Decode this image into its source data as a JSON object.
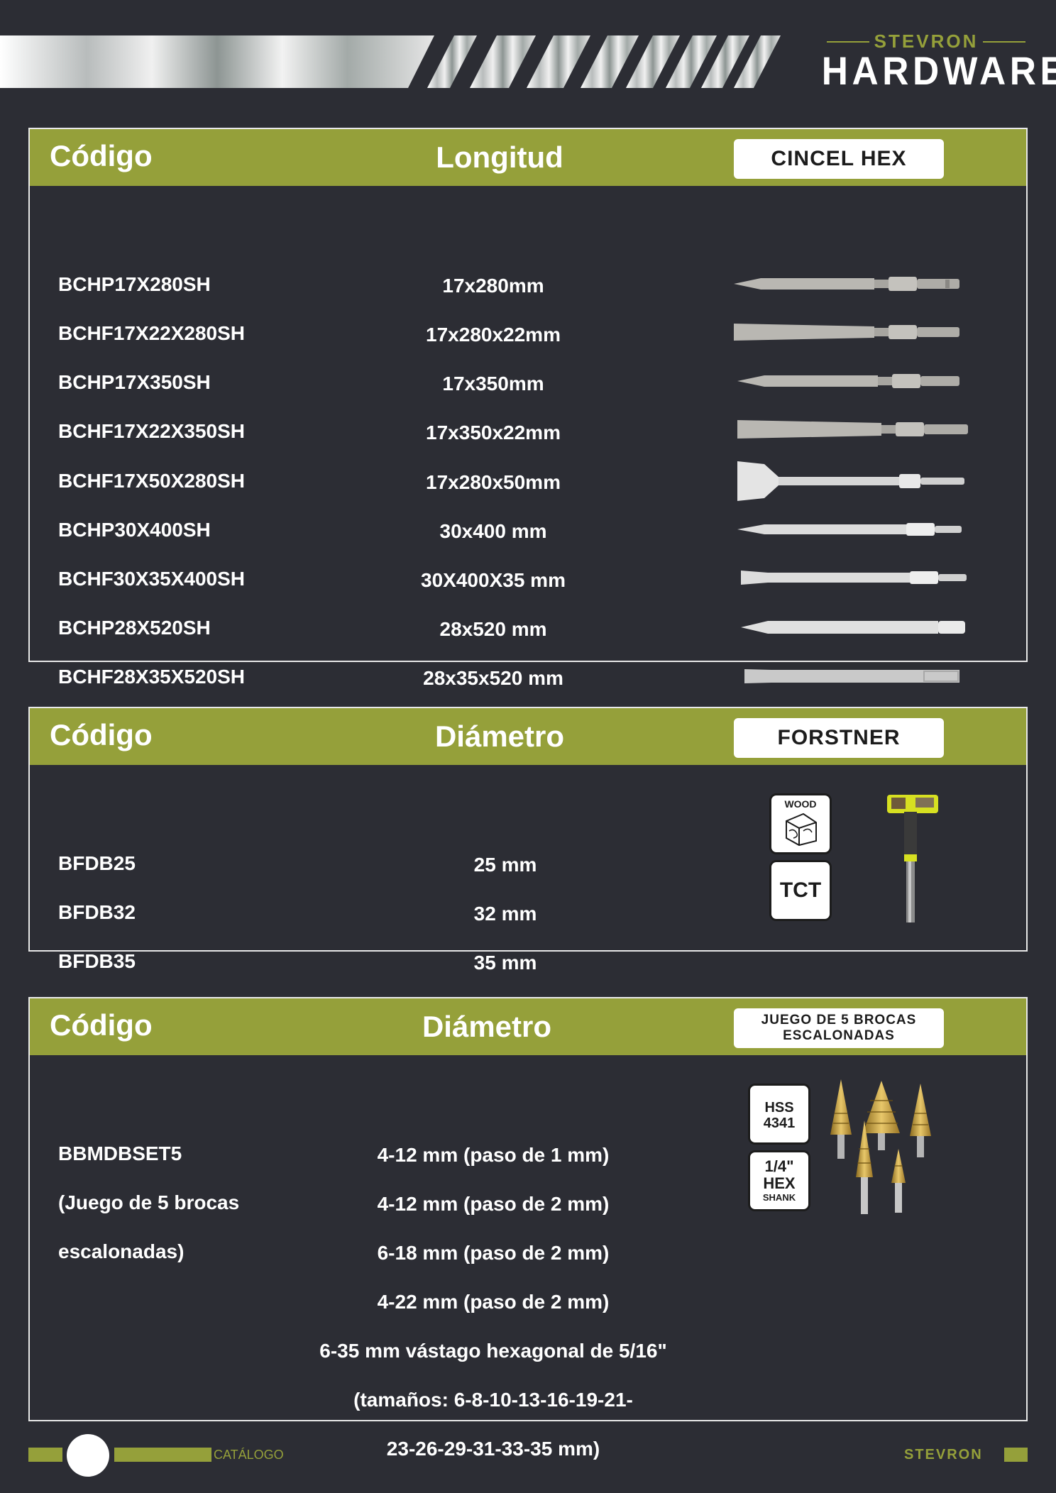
{
  "brand": {
    "small": "STEVRON",
    "big": "HARDWARE"
  },
  "colors": {
    "accent": "#95a03a",
    "background": "#2c2d34",
    "border": "#e8e8e8"
  },
  "sections": [
    {
      "header": {
        "code": "Código",
        "column": "Longitud",
        "tag": "CINCEL HEX"
      },
      "rows": [
        {
          "code": "BCHP17X280SH",
          "value": "17x280mm",
          "image": "pointed-hex-chisel"
        },
        {
          "code": "BCHF17X22X280SH",
          "value": "17x280x22mm",
          "image": "flat-hex-chisel"
        },
        {
          "code": "BCHP17X350SH",
          "value": "17x350mm",
          "image": "pointed-hex-chisel"
        },
        {
          "code": "BCHF17X22X350SH",
          "value": "17x350x22mm",
          "image": "flat-hex-chisel"
        },
        {
          "code": "BCHF17X50X280SH",
          "value": "17x280x50mm",
          "image": "wide-hex-chisel"
        },
        {
          "code": "BCHP30X400SH",
          "value": "30x400 mm",
          "image": "pointed-hex-chisel"
        },
        {
          "code": "BCHF30X35X400SH",
          "value": "30X400X35 mm",
          "image": "flat-hex-chisel"
        },
        {
          "code": "BCHP28X520SH",
          "value": "28x520 mm",
          "image": "pointed-hex-chisel"
        },
        {
          "code": "BCHF28X35X520SH",
          "value": "28x35x520 mm",
          "image": "flat-hex-chisel"
        }
      ]
    },
    {
      "header": {
        "code": "Código",
        "column": "Diámetro",
        "tag": "FORSTNER"
      },
      "rows": [
        {
          "code": "BFDB25",
          "value": "25 mm"
        },
        {
          "code": "BFDB32",
          "value": "32 mm"
        },
        {
          "code": "BFDB35",
          "value": "35 mm"
        }
      ],
      "badges": {
        "wood": "WOOD",
        "tct": "TCT"
      },
      "image": "forstner-bit"
    },
    {
      "header": {
        "code": "Código",
        "column": "Diámetro",
        "tag_line1": "JUEGO DE 5 BROCAS",
        "tag_line2": "ESCALONADAS"
      },
      "code_lines": [
        "BBMDBSET5",
        "(Juego de 5 brocas",
        "escalonadas)"
      ],
      "values": [
        "4-12 mm (paso de 1 mm)",
        "4-12 mm (paso de 2 mm)",
        "6-18 mm (paso de 2 mm)",
        "4-22 mm (paso de 2 mm)",
        "6-35 mm vástago hexagonal de 5/16\"",
        "(tamaños: 6-8-10-13-16-19-21-",
        "23-26-29-31-33-35 mm)"
      ],
      "badges": {
        "hss_line1": "HSS",
        "hss_line2": "4341",
        "hex_line1": "1/4\"",
        "hex_line2": "HEX",
        "hex_line3": "SHANK"
      },
      "image": "step-drill-bits"
    }
  ],
  "footer": {
    "catalog": "CATÁLOGO",
    "brand": "STEVRON"
  }
}
